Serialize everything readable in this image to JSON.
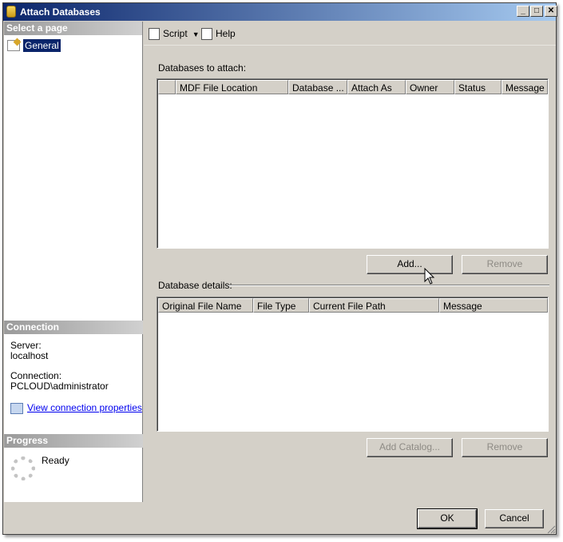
{
  "window": {
    "title": "Attach Databases",
    "controls": [
      "_",
      "□",
      "✕"
    ]
  },
  "sidebar": {
    "select_page_header": "Select a page",
    "pages": [
      {
        "label": "General",
        "icon": "page-icon",
        "selected": true
      }
    ],
    "connection": {
      "header": "Connection",
      "server_label": "Server:",
      "server_value": "localhost",
      "connection_label": "Connection:",
      "connection_value": "PCLOUD\\administrator",
      "view_properties_link": "View connection properties"
    },
    "progress": {
      "header": "Progress",
      "status": "Ready"
    }
  },
  "toolbar": {
    "script_label": "Script",
    "help_label": "Help"
  },
  "attach_section": {
    "label": "Databases to attach:",
    "columns": [
      "",
      "MDF File Location",
      "Database ...",
      "Attach As",
      "Owner",
      "Status",
      "Message"
    ],
    "rows": [],
    "add_button": "Add...",
    "remove_button": "Remove"
  },
  "details_section": {
    "label": "Database details:",
    "columns": [
      "Original File Name",
      "File Type",
      "Current File Path",
      "Message"
    ],
    "rows": [],
    "add_catalog_button": "Add Catalog...",
    "remove_button": "Remove"
  },
  "footer": {
    "ok_button": "OK",
    "cancel_button": "Cancel"
  },
  "colors": {
    "title_bar": "#0a246a",
    "dialog_background": "#d4d0c8",
    "link": "#0000ee",
    "disabled_text": "#8e8b85"
  }
}
